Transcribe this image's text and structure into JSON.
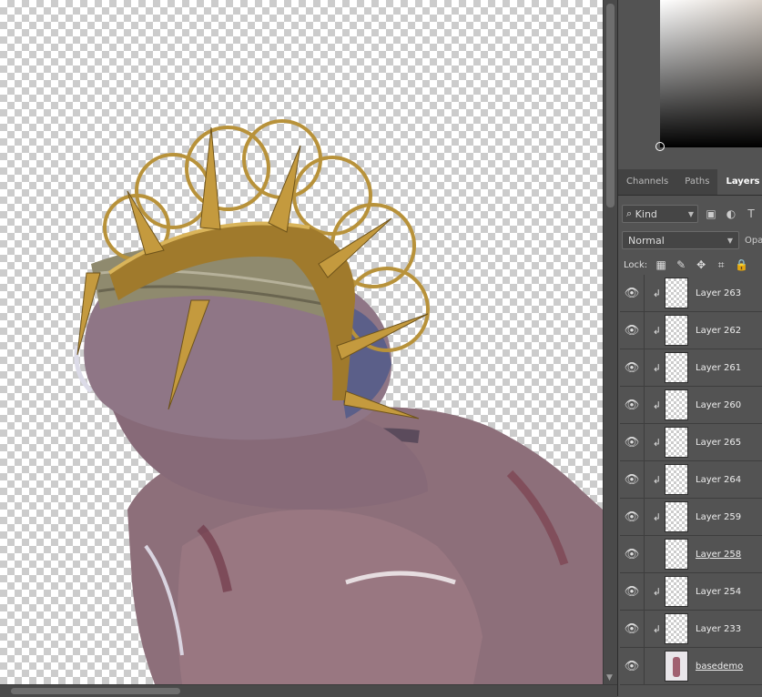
{
  "panel": {
    "tabs": [
      {
        "label": "Channels",
        "active": false
      },
      {
        "label": "Paths",
        "active": false
      },
      {
        "label": "Layers",
        "active": true
      }
    ],
    "filter_kind": "Kind",
    "blend_mode": "Normal",
    "opacity_label": "Opa",
    "lock_label": "Lock:",
    "layers": [
      {
        "name": "Layer 263",
        "clipped": true,
        "visible": true
      },
      {
        "name": "Layer 262",
        "clipped": true,
        "visible": true
      },
      {
        "name": "Layer 261",
        "clipped": true,
        "visible": true
      },
      {
        "name": "Layer 260",
        "clipped": true,
        "visible": true
      },
      {
        "name": "Layer 265",
        "clipped": true,
        "visible": true
      },
      {
        "name": "Layer 264",
        "clipped": true,
        "visible": true
      },
      {
        "name": "Layer 259",
        "clipped": true,
        "visible": true
      },
      {
        "name": "Layer 258",
        "clipped": false,
        "visible": true
      },
      {
        "name": "Layer 254",
        "clipped": true,
        "visible": true
      },
      {
        "name": "Layer 233",
        "clipped": true,
        "visible": true
      },
      {
        "name": "basedemo",
        "clipped": false,
        "visible": true
      }
    ]
  },
  "colors": {
    "panel_bg": "#535353",
    "canvas_checker": "#cccccc",
    "crown_gold": "#b8923a",
    "skin": "#8a6a78"
  },
  "icons": {
    "eye": "eye-icon",
    "clip": "clip-arrow-icon",
    "search": "search-icon",
    "lock": "lock-icon"
  }
}
